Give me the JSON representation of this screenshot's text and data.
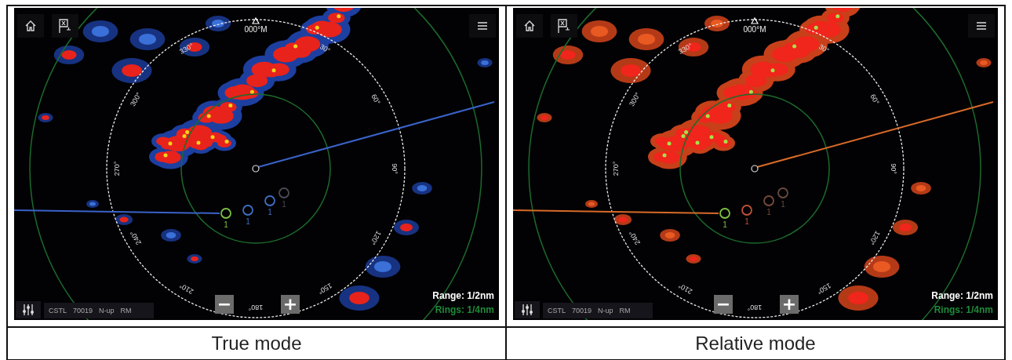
{
  "panels": [
    {
      "kind": "true",
      "caption": "True mode",
      "heading": "000°M",
      "bearings": [
        "30°",
        "60°",
        "90°",
        "120°",
        "150°",
        "180°",
        "210°",
        "240°",
        "270°",
        "300°",
        "330°"
      ],
      "targets": [
        {
          "label": "1",
          "color": "#7cc242"
        },
        {
          "label": "1",
          "color": "#3f6fc4"
        },
        {
          "label": "1",
          "color": "#3f6fc4"
        },
        {
          "label": "1",
          "color": "#4a4a55"
        }
      ],
      "status_items": [
        "CSTL",
        "70019",
        "N-up",
        "RM"
      ],
      "zoom_out": "−",
      "zoom_in": "+",
      "range": "Range: 1/2nm",
      "rings": "Rings: 1/4nm"
    },
    {
      "kind": "relative",
      "caption": "Relative mode",
      "heading": "000°M",
      "bearings": [
        "30°",
        "60°",
        "90°",
        "120°",
        "150°",
        "180°",
        "210°",
        "240°",
        "270°",
        "300°",
        "330°"
      ],
      "targets": [
        {
          "label": "1",
          "color": "#7cc242"
        },
        {
          "label": "1",
          "color": "#c0503a"
        },
        {
          "label": "1",
          "color": "#7a4a3a"
        },
        {
          "label": "1",
          "color": "#6a4a40"
        }
      ],
      "status_items": [
        "CSTL",
        "70019",
        "N-up",
        "RM"
      ],
      "zoom_out": "−",
      "zoom_in": "+",
      "range": "Range: 1/2nm",
      "rings": "Rings: 1/4nm"
    }
  ]
}
